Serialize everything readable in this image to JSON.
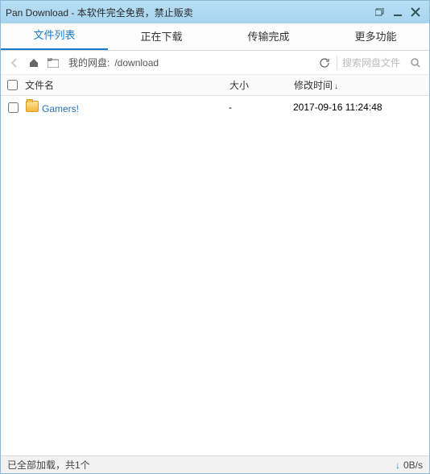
{
  "window": {
    "title": "Pan Download - 本软件完全免费，禁止贩卖"
  },
  "tabs": {
    "file_list": "文件列表",
    "downloading": "正在下载",
    "finished": "传输完成",
    "more": "更多功能",
    "active": 0
  },
  "toolbar": {
    "path_label": "我的网盘:",
    "path_value": "/download",
    "search_placeholder": "搜索网盘文件"
  },
  "columns": {
    "name": "文件名",
    "size": "大小",
    "mtime": "修改时间"
  },
  "files": [
    {
      "name": "Gamers!",
      "size": "-",
      "mtime": "2017-09-16 11:24:48"
    }
  ],
  "status": {
    "text": "已全部加载，共1个",
    "rate": "0B/s"
  }
}
